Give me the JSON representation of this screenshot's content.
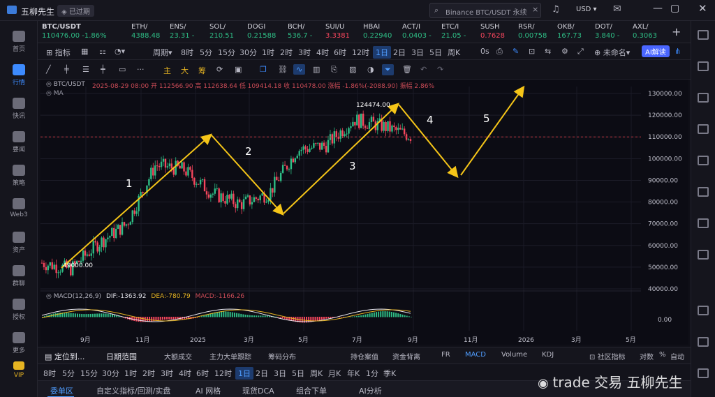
{
  "window": {
    "app_name": "五柳先生",
    "status_badge": "已过期",
    "search_placeholder": "Binance BTC/USDT 永续",
    "currency": "USD"
  },
  "sidebar": {
    "items": [
      {
        "label": "首页"
      },
      {
        "label": "行情"
      },
      {
        "label": "快讯"
      },
      {
        "label": "要闻"
      },
      {
        "label": "策略"
      },
      {
        "label": "Web3"
      },
      {
        "label": "资产"
      },
      {
        "label": "群聊"
      },
      {
        "label": "授权"
      },
      {
        "label": "更多"
      },
      {
        "label": "VIP"
      }
    ]
  },
  "tickers": [
    {
      "name": "BTC/USDT",
      "value": "110476.00 -1.86%"
    },
    {
      "name": "ETH/",
      "value": "4388.48"
    },
    {
      "name": "ENS/",
      "value": "23.31 -"
    },
    {
      "name": "SOL/",
      "value": "210.51"
    },
    {
      "name": "DOGI",
      "value": "0.21588"
    },
    {
      "name": "BCH/",
      "value": "536.7 -"
    },
    {
      "name": "SUI/U",
      "value": "3.3381"
    },
    {
      "name": "HBAI",
      "value": "0.22940"
    },
    {
      "name": "ACT/I",
      "value": "0.0403 -"
    },
    {
      "name": "ETC/I",
      "value": "21.05 -"
    },
    {
      "name": "SUSH",
      "value": "0.7628"
    },
    {
      "name": "RSR/",
      "value": "0.00758"
    },
    {
      "name": "OKB/",
      "value": "167.73"
    },
    {
      "name": "DOT/",
      "value": "3.840 -"
    },
    {
      "name": "AXL/",
      "value": "0.3063"
    }
  ],
  "toolbar1": {
    "indicators": "指标",
    "period": "周期",
    "intervals": [
      "8时",
      "5分",
      "15分",
      "30分",
      "1时",
      "2时",
      "3时",
      "4时",
      "6时",
      "12时",
      "1日",
      "2日",
      "3日",
      "5日",
      "周K"
    ],
    "active_interval": "1日",
    "zero_s": "0s",
    "unnamed": "未命名",
    "ai": "AI解读"
  },
  "toolbar2": {
    "chars": [
      "主",
      "大",
      "筹"
    ]
  },
  "chart_info": {
    "symbol": "BTC/USDT",
    "line": "2025-08-29 08:00  开 112566.90  高 112638.64  低 109414.18  收 110478.00  涨幅 -1.86%(-2088.90)  振幅 2.86%",
    "ma": "MA"
  },
  "chart_data": {
    "type": "line",
    "title": "BTC/USDT",
    "y_ticks": [
      "130000.00",
      "120000.00",
      "110000.00",
      "100000.00",
      "90000.00",
      "80000.00",
      "70000.00",
      "60000.00",
      "50000.00",
      "40000.00"
    ],
    "x_ticks": [
      "9月",
      "11月",
      "2025",
      "3月",
      "5月",
      "7月",
      "9月",
      "11月",
      "2026",
      "3月",
      "5月"
    ],
    "ylim": [
      40000,
      130000
    ],
    "current_price_line": 110000,
    "price_path": [
      {
        "x": "2024-08",
        "y": 52000
      },
      {
        "x": "2024-09",
        "y": 49000
      },
      {
        "x": "2024-10",
        "y": 61000
      },
      {
        "x": "2024-11",
        "y": 70000
      },
      {
        "x": "2024-12",
        "y": 97000
      },
      {
        "x": "2025-01",
        "y": 95000
      },
      {
        "x": "2025-02",
        "y": 84000
      },
      {
        "x": "2025-03",
        "y": 79000
      },
      {
        "x": "2025-04",
        "y": 84000
      },
      {
        "x": "2025-05",
        "y": 104000
      },
      {
        "x": "2025-06",
        "y": 106000
      },
      {
        "x": "2025-07",
        "y": 118000
      },
      {
        "x": "2025-08",
        "y": 115000
      },
      {
        "x": "2025-08-29",
        "y": 110478
      }
    ],
    "annotations": {
      "waves": [
        "1",
        "2",
        "3",
        "4",
        "5"
      ],
      "low_label": "49000.00",
      "high_label": "124474.00"
    },
    "macd": {
      "label": "MACD(12,26,9)",
      "dif": "DIF:-1363.92",
      "dea": "DEA:-780.79",
      "macd": "MACD:-1166.26",
      "zero_tick": "0.00"
    }
  },
  "bottom1": {
    "locate": "定位到...",
    "date_range": "日期范围",
    "tabs": [
      "大额成交",
      "主力大单跟踪",
      "筹码分布",
      "持仓案值",
      "资金背离",
      "FR",
      "MACD",
      "Volume",
      "KDJ"
    ],
    "active_tab": "MACD",
    "community": "社区指标",
    "log": "对数",
    "percent": "%",
    "auto": "自动"
  },
  "bottom2": {
    "intervals": [
      "8时",
      "5分",
      "15分",
      "30分",
      "1时",
      "2时",
      "3时",
      "4时",
      "6时",
      "12时",
      "1日",
      "2日",
      "3日",
      "5日",
      "周K",
      "月K",
      "年K",
      "1分",
      "季K"
    ],
    "active": "1日"
  },
  "bottom3": {
    "tabs": [
      "委单区",
      "自定义指标/回测/实盘",
      "AI 网格",
      "现货DCA",
      "组合下单",
      "AI分析"
    ],
    "active": "委单区"
  },
  "watermark": "trade 交易 五柳先生"
}
